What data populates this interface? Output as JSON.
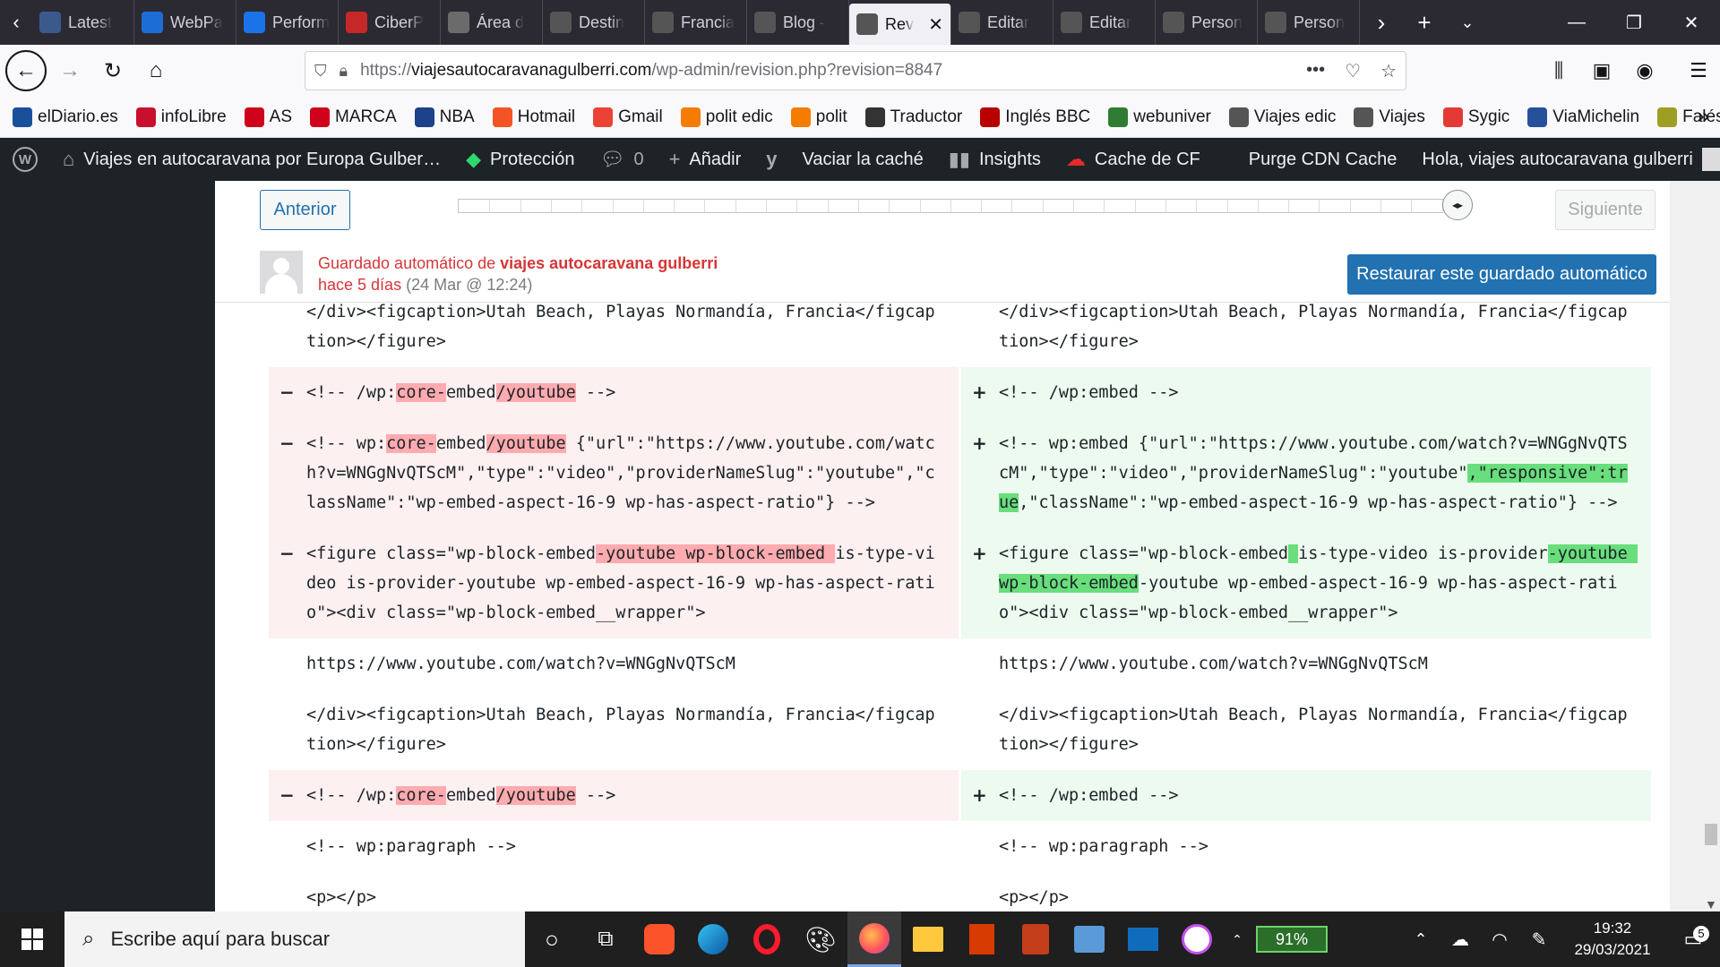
{
  "browser": {
    "tabs": [
      {
        "label": "Latest",
        "icon": "gt-icon",
        "color": "#3a5a8c"
      },
      {
        "label": "WebPa",
        "icon": "globe-icon",
        "color": "#1c6ed6"
      },
      {
        "label": "Perform",
        "icon": "perf-icon",
        "color": "#1a73e8"
      },
      {
        "label": "CiberP",
        "icon": "shield-icon",
        "color": "#c62828"
      },
      {
        "label": "Área d",
        "icon": "folder-icon",
        "color": "#6b6b6b"
      },
      {
        "label": "Destin",
        "icon": "page-icon",
        "color": "#555"
      },
      {
        "label": "Francia",
        "icon": "page-icon",
        "color": "#555"
      },
      {
        "label": "Blog -",
        "icon": "page-icon",
        "color": "#555"
      },
      {
        "label": "Rev",
        "icon": "page-icon",
        "color": "#555",
        "active": true
      },
      {
        "label": "Editar",
        "icon": "page-icon",
        "color": "#555"
      },
      {
        "label": "Editar",
        "icon": "page-icon",
        "color": "#555"
      },
      {
        "label": "Person",
        "icon": "page-icon",
        "color": "#555"
      },
      {
        "label": "Person",
        "icon": "page-icon",
        "color": "#555"
      }
    ],
    "url": {
      "protocol": "https://",
      "host": "viajesautocaravanagulberri.com",
      "path": "/wp-admin/revision.php?revision=8847"
    },
    "bookmarks": [
      {
        "label": "elDiario.es",
        "color": "#1a4f9c"
      },
      {
        "label": "infoLibre",
        "color": "#c8102e"
      },
      {
        "label": "AS",
        "color": "#d0021b"
      },
      {
        "label": "MARCA",
        "color": "#d0021b"
      },
      {
        "label": "NBA",
        "color": "#1d428a"
      },
      {
        "label": "Hotmail",
        "color": "#f35325"
      },
      {
        "label": "Gmail",
        "color": "#ea4335"
      },
      {
        "label": "polit edic",
        "color": "#f57c00"
      },
      {
        "label": "polit",
        "color": "#f57c00"
      },
      {
        "label": "Traductor",
        "color": "#333"
      },
      {
        "label": "Inglés BBC",
        "color": "#b80000"
      },
      {
        "label": "webuniver",
        "color": "#2e7d32"
      },
      {
        "label": "Viajes edic",
        "color": "#555"
      },
      {
        "label": "Viajes",
        "color": "#555"
      },
      {
        "label": "Sygic",
        "color": "#e53935"
      },
      {
        "label": "ViaMichelin",
        "color": "#27509b"
      },
      {
        "label": "Falésia",
        "color": "#9e9d24"
      }
    ]
  },
  "adminbar": {
    "site": "Viajes en autocaravana por Europa Gulber…",
    "proteccion": "Protección",
    "comments": "0",
    "add": "Añadir",
    "cache": "Vaciar la caché",
    "insights": "Insights",
    "cf": "Cache de CF",
    "purge": "Purge CDN Cache",
    "greeting": "Hola, viajes autocaravana gulberri"
  },
  "revision": {
    "prev_label": "Anterior",
    "next_label": "Siguiente",
    "autosave_prefix": "Guardado automático de ",
    "author": "viajes autocaravana gulberri",
    "ago": "hace 5 días",
    "date": "(24 Mar @ 12:24)",
    "restore_label": "Restaurar este guardado automático"
  },
  "diff_rows": [
    {
      "left": {
        "type": "ctx",
        "parts": [
          [
            "</div><figcaption>Utah Beach, Playas Normandía, Francia</figcaption></figure>",
            ""
          ]
        ]
      },
      "right": {
        "type": "ctx",
        "parts": [
          [
            "</div><figcaption>Utah Beach, Playas Normandía, Francia</figcaption></figure>",
            ""
          ]
        ]
      }
    },
    {
      "left": {
        "type": "del",
        "parts": [
          [
            "<!-- /wp:",
            ""
          ],
          [
            "core-",
            "h"
          ],
          [
            "embed",
            ""
          ],
          [
            "/youtube",
            "h"
          ],
          [
            " -->",
            ""
          ]
        ]
      },
      "right": {
        "type": "add",
        "parts": [
          [
            "<!-- /wp:embed -->",
            ""
          ]
        ]
      }
    },
    {
      "left": {
        "type": "del",
        "parts": [
          [
            "<!-- wp:",
            ""
          ],
          [
            "core-",
            "h"
          ],
          [
            "embed",
            ""
          ],
          [
            "/youtube",
            "h"
          ],
          [
            " {\"url\":\"https://www.youtube.com/watch?v=WNGgNvQTScM\",\"type\":\"video\",\"providerNameSlug\":\"youtube\",\"className\":\"wp-embed-aspect-16-9 wp-has-aspect-ratio\"} -->",
            ""
          ]
        ]
      },
      "right": {
        "type": "add",
        "parts": [
          [
            "<!-- wp:embed {\"url\":\"https://www.youtube.com/watch?v=WNGgNvQTScM\",\"type\":\"video\",\"providerNameSlug\":\"youtube\"",
            ""
          ],
          [
            ",\"responsive\":true",
            "h"
          ],
          [
            ",\"className\":\"wp-embed-aspect-16-9 wp-has-aspect-ratio\"} -->",
            ""
          ]
        ]
      }
    },
    {
      "left": {
        "type": "del",
        "parts": [
          [
            "<figure class=\"wp-block-embed",
            ""
          ],
          [
            "-youtube wp-block-embed ",
            "h"
          ],
          [
            "is-type-video is-provider-youtube wp-embed-aspect-16-9 wp-has-aspect-ratio\"><div class=\"wp-block-embed__wrapper\">",
            ""
          ]
        ]
      },
      "right": {
        "type": "add",
        "parts": [
          [
            "<figure class=\"wp-block-embed",
            ""
          ],
          [
            " ",
            "h"
          ],
          [
            "is-type-video is-provider",
            ""
          ],
          [
            "-youtube wp-block-embed",
            "h"
          ],
          [
            "-youtube wp-embed-aspect-16-9 wp-has-aspect-ratio\"><div class=\"wp-block-embed__wrapper\">",
            ""
          ]
        ]
      }
    },
    {
      "left": {
        "type": "ctx",
        "parts": [
          [
            "https://www.youtube.com/watch?v=WNGgNvQTScM",
            ""
          ]
        ]
      },
      "right": {
        "type": "ctx",
        "parts": [
          [
            "https://www.youtube.com/watch?v=WNGgNvQTScM",
            ""
          ]
        ]
      }
    },
    {
      "left": {
        "type": "ctx",
        "parts": [
          [
            "</div><figcaption>Utah Beach, Playas Normandía, Francia</figcaption></figure>",
            ""
          ]
        ]
      },
      "right": {
        "type": "ctx",
        "parts": [
          [
            "</div><figcaption>Utah Beach, Playas Normandía, Francia</figcaption></figure>",
            ""
          ]
        ]
      }
    },
    {
      "left": {
        "type": "del",
        "parts": [
          [
            "<!-- /wp:",
            ""
          ],
          [
            "core-",
            "h"
          ],
          [
            "embed",
            ""
          ],
          [
            "/youtube",
            "h"
          ],
          [
            " -->",
            ""
          ]
        ]
      },
      "right": {
        "type": "add",
        "parts": [
          [
            "<!-- /wp:embed -->",
            ""
          ]
        ]
      }
    },
    {
      "left": {
        "type": "ctx",
        "parts": [
          [
            "<!-- wp:paragraph -->",
            ""
          ]
        ]
      },
      "right": {
        "type": "ctx",
        "parts": [
          [
            "<!-- wp:paragraph -->",
            ""
          ]
        ]
      }
    },
    {
      "left": {
        "type": "ctx",
        "parts": [
          [
            "<p></p>",
            ""
          ]
        ]
      },
      "right": {
        "type": "ctx",
        "parts": [
          [
            "<p></p>",
            ""
          ]
        ]
      }
    }
  ],
  "taskbar": {
    "search_placeholder": "Escribe aquí para buscar",
    "battery": "91%",
    "time": "19:32",
    "date": "29/03/2021",
    "notifications": "5"
  }
}
